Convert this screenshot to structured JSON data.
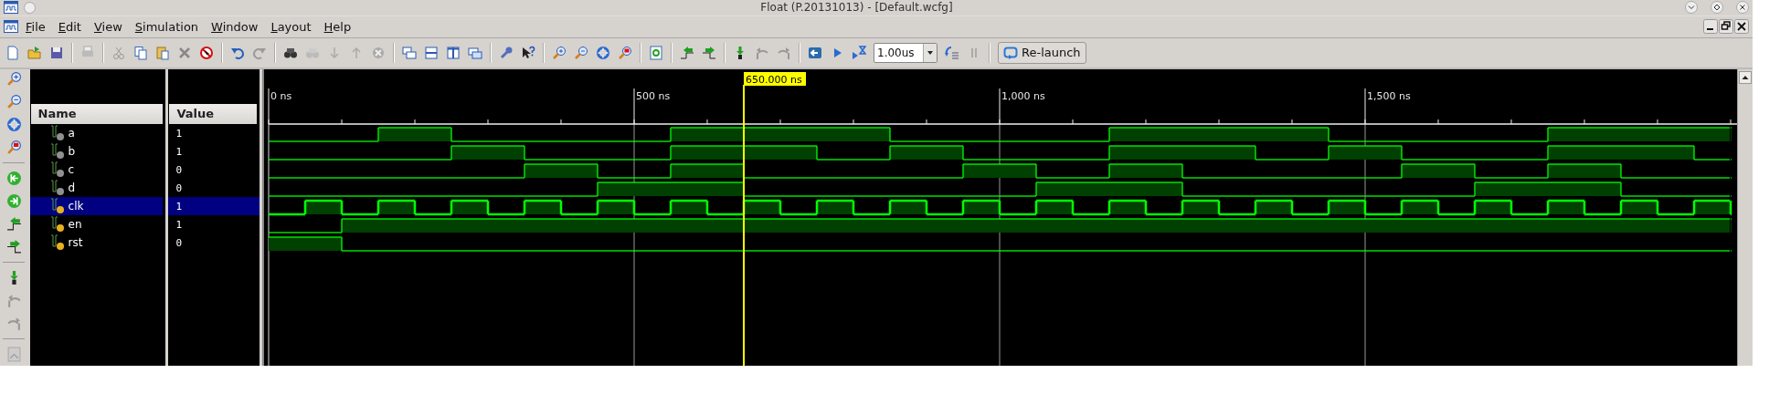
{
  "window": {
    "title": "Float (P.20131013) - [Default.wcfg]"
  },
  "menu": [
    {
      "label": "File"
    },
    {
      "label": "Edit"
    },
    {
      "label": "View"
    },
    {
      "label": "Simulation"
    },
    {
      "label": "Window"
    },
    {
      "label": "Layout"
    },
    {
      "label": "Help"
    }
  ],
  "toolbar": {
    "run_time": "1.00us",
    "relaunch": "Re-launch"
  },
  "columns": {
    "name": "Name",
    "value": "Value"
  },
  "timeline": {
    "labels": [
      "0 ns",
      "500 ns",
      "1,000 ns",
      "1,500 ns"
    ],
    "cursor": "650.000 ns"
  },
  "signals": [
    {
      "name": "a",
      "value": "1",
      "color": "#909090",
      "selected": false,
      "wave": [
        false,
        false,
        false,
        true,
        true,
        false,
        false,
        false,
        false,
        false,
        false,
        true,
        true,
        true,
        true,
        true,
        true,
        false,
        false,
        false,
        false,
        false,
        false,
        true,
        true,
        true,
        true,
        true,
        true,
        false,
        false,
        false,
        false,
        false,
        false,
        true,
        true,
        true,
        true,
        true,
        true
      ]
    },
    {
      "name": "b",
      "value": "1",
      "color": "#909090",
      "selected": false,
      "wave": [
        false,
        false,
        false,
        false,
        false,
        true,
        true,
        false,
        false,
        false,
        false,
        true,
        true,
        true,
        true,
        false,
        false,
        true,
        true,
        false,
        false,
        false,
        false,
        true,
        true,
        true,
        true,
        false,
        false,
        true,
        true,
        false,
        false,
        false,
        false,
        true,
        true,
        true,
        true,
        false,
        false
      ]
    },
    {
      "name": "c",
      "value": "0",
      "color": "#909090",
      "selected": false,
      "wave": [
        false,
        false,
        false,
        false,
        false,
        false,
        false,
        true,
        true,
        false,
        false,
        true,
        true,
        false,
        false,
        false,
        false,
        false,
        false,
        true,
        true,
        false,
        false,
        true,
        true,
        false,
        false,
        false,
        false,
        false,
        false,
        true,
        true,
        false,
        false,
        true,
        true,
        false,
        false,
        false,
        false
      ]
    },
    {
      "name": "d",
      "value": "0",
      "color": "#909090",
      "selected": false,
      "wave": [
        false,
        false,
        false,
        false,
        false,
        false,
        false,
        false,
        false,
        true,
        true,
        true,
        true,
        false,
        false,
        false,
        false,
        false,
        false,
        false,
        false,
        true,
        true,
        true,
        true,
        false,
        false,
        false,
        false,
        false,
        false,
        false,
        false,
        true,
        true,
        true,
        true,
        false,
        false,
        false,
        false
      ]
    },
    {
      "name": "clk",
      "value": "1",
      "color": "#e8b020",
      "selected": true,
      "wave": [
        false,
        true,
        false,
        true,
        false,
        true,
        false,
        true,
        false,
        true,
        false,
        true,
        false,
        true,
        false,
        true,
        false,
        true,
        false,
        true,
        false,
        true,
        false,
        true,
        false,
        true,
        false,
        true,
        false,
        true,
        false,
        true,
        false,
        true,
        false,
        true,
        false,
        true,
        false,
        true,
        false
      ]
    },
    {
      "name": "en",
      "value": "1",
      "color": "#e8b020",
      "selected": false,
      "wave": [
        false,
        false,
        true,
        true,
        true,
        true,
        true,
        true,
        true,
        true,
        true,
        true,
        true,
        true,
        true,
        true,
        true,
        true,
        true,
        true,
        true,
        true,
        true,
        true,
        true,
        true,
        true,
        true,
        true,
        true,
        true,
        true,
        true,
        true,
        true,
        true,
        true,
        true,
        true,
        true,
        true
      ]
    },
    {
      "name": "rst",
      "value": "0",
      "color": "#e8b020",
      "selected": false,
      "wave": [
        true,
        true,
        false,
        false,
        false,
        false,
        false,
        false,
        false,
        false,
        false,
        false,
        false,
        false,
        false,
        false,
        false,
        false,
        false,
        false,
        false,
        false,
        false,
        false,
        false,
        false,
        false,
        false,
        false,
        false,
        false,
        false,
        false,
        false,
        false,
        false,
        false,
        false,
        false,
        false,
        false
      ]
    }
  ]
}
